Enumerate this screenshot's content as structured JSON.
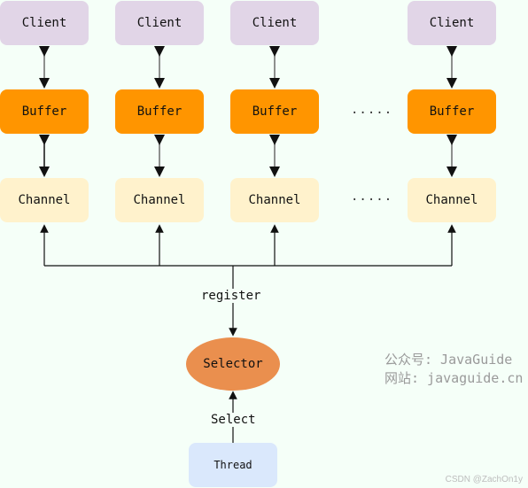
{
  "clients": [
    {
      "label": "Client"
    },
    {
      "label": "Client"
    },
    {
      "label": "Client"
    },
    {
      "label": "Client"
    }
  ],
  "buffers": [
    {
      "label": "Buffer"
    },
    {
      "label": "Buffer"
    },
    {
      "label": "Buffer"
    },
    {
      "label": "Buffer"
    }
  ],
  "channels": [
    {
      "label": "Channel"
    },
    {
      "label": "Channel"
    },
    {
      "label": "Channel"
    },
    {
      "label": "Channel"
    }
  ],
  "ellipsis": ".....",
  "register_label": "register",
  "selector_label": "Selector",
  "select_label": "Select",
  "thread_label": "Thread",
  "watermark": {
    "line1": "公众号: JavaGuide",
    "line2": "网站: javaguide.cn"
  },
  "csdn_credit": "CSDN @ZachOn1y",
  "colors": {
    "client": "#e1d5e7",
    "buffer": "#ff9500",
    "channel": "#fff2cc",
    "selector": "#ea8f4e",
    "thread": "#dae8fc"
  }
}
